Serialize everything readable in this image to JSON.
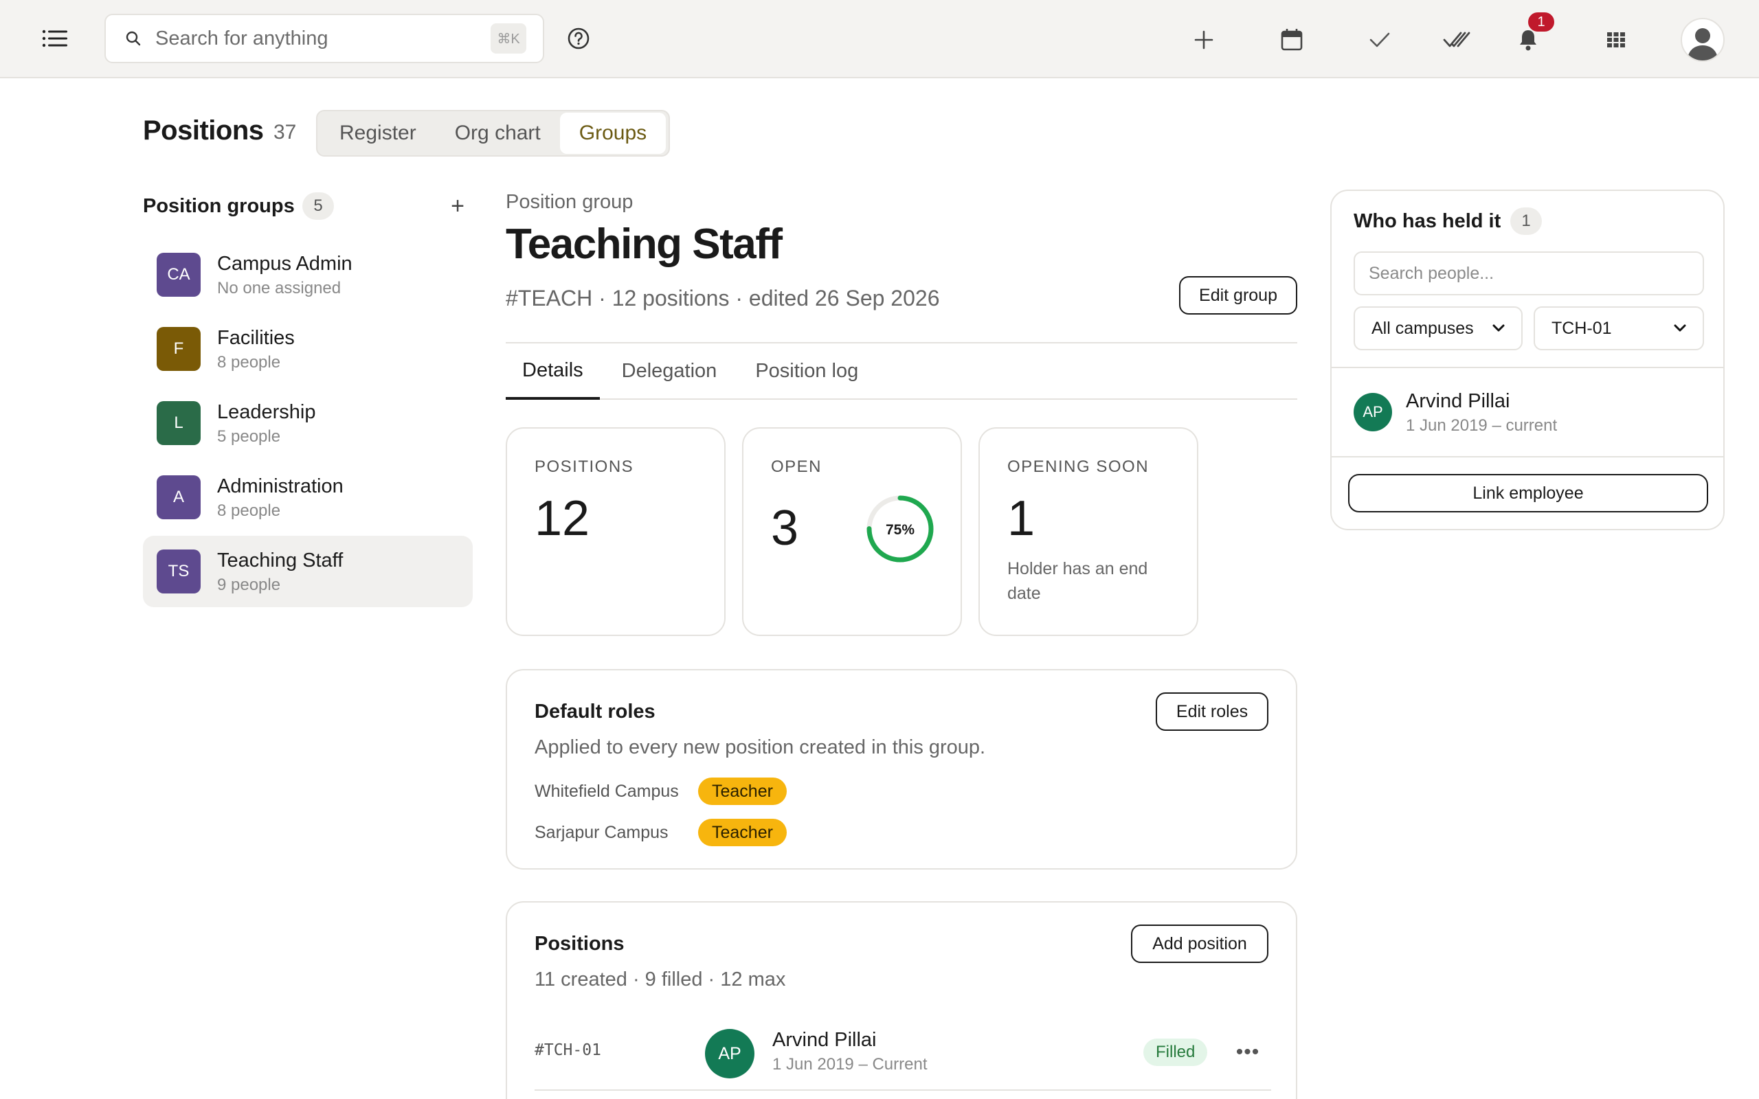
{
  "topbar": {
    "search_placeholder": "Search for anything",
    "search_shortcut": "⌘K",
    "notification_count": "1",
    "icons": [
      "menu-icon",
      "search-icon",
      "help-icon",
      "plus-icon",
      "calendar-icon",
      "check-icon",
      "double-check-icon",
      "bell-icon",
      "apps-grid-icon",
      "user-avatar-icon"
    ]
  },
  "header": {
    "title": "Positions",
    "count": "37",
    "tabs": [
      {
        "label": "Register",
        "active": false
      },
      {
        "label": "Org chart",
        "active": false
      },
      {
        "label": "Groups",
        "active": true
      }
    ]
  },
  "groups": {
    "heading": "Position groups",
    "count": "5",
    "add_label": "+",
    "items": [
      {
        "initials": "CA",
        "name": "Campus Admin",
        "sub": "No one assigned",
        "color": "#5e4a8f"
      },
      {
        "initials": "F",
        "name": "Facilities",
        "sub": "8 people",
        "color": "#7a5a06"
      },
      {
        "initials": "L",
        "name": "Leadership",
        "sub": "5 people",
        "color": "#2a6b48"
      },
      {
        "initials": "A",
        "name": "Administration",
        "sub": "8 people",
        "color": "#5e4a8f"
      },
      {
        "initials": "TS",
        "name": "Teaching Staff",
        "sub": "9 people",
        "color": "#5e4a8f",
        "active": true
      }
    ]
  },
  "detail": {
    "crumb": "Position group",
    "title": "Teaching Staff",
    "meta": "#TEACH · 12 positions · edited 26 Sep 2026",
    "edit_button": "Edit group",
    "tabs": [
      {
        "label": "Details",
        "active": true
      },
      {
        "label": "Delegation",
        "active": false
      },
      {
        "label": "Position log",
        "active": false
      }
    ],
    "stats": {
      "positions": {
        "label": "POSITIONS",
        "value": "12"
      },
      "open": {
        "label": "OPEN",
        "value": "3",
        "ring_label": "75%",
        "ring_fraction": 0.75
      },
      "opening_soon": {
        "label": "OPENING SOON",
        "value": "1",
        "note": "Holder has an end date"
      }
    },
    "roles_card": {
      "heading": "Default roles",
      "edit_button": "Edit roles",
      "description": "Applied to every new position created in this group.",
      "rows": [
        {
          "campus": "Whitefield Campus",
          "role": "Teacher"
        },
        {
          "campus": "Sarjapur Campus",
          "role": "Teacher"
        }
      ]
    },
    "positions_card": {
      "heading": "Positions",
      "add_button": "Add position",
      "summary": "11 created · 9 filled · 12 max",
      "rows": [
        {
          "code": "#TCH-01",
          "initials": "AP",
          "name": "Arvind Pillai",
          "dates": "1 Jun 2019 – Current",
          "status": "Filled",
          "more": "•••"
        }
      ]
    }
  },
  "panel": {
    "heading": "Who has held it",
    "count": "1",
    "search_placeholder": "Search people...",
    "campus_filter": "All campuses",
    "position_filter": "TCH-01",
    "holder": {
      "initials": "AP",
      "name": "Arvind Pillai",
      "dates": "1 Jun 2019 – current"
    },
    "link_button": "Link employee"
  },
  "colors": {
    "accent_tab_text": "#6b5a12",
    "chip_yellow": "#f7b50e",
    "avatar_green": "#137a55",
    "ring_green": "#1fa84f",
    "badge_red": "#c0192c",
    "filled_green": "#267a3c"
  }
}
